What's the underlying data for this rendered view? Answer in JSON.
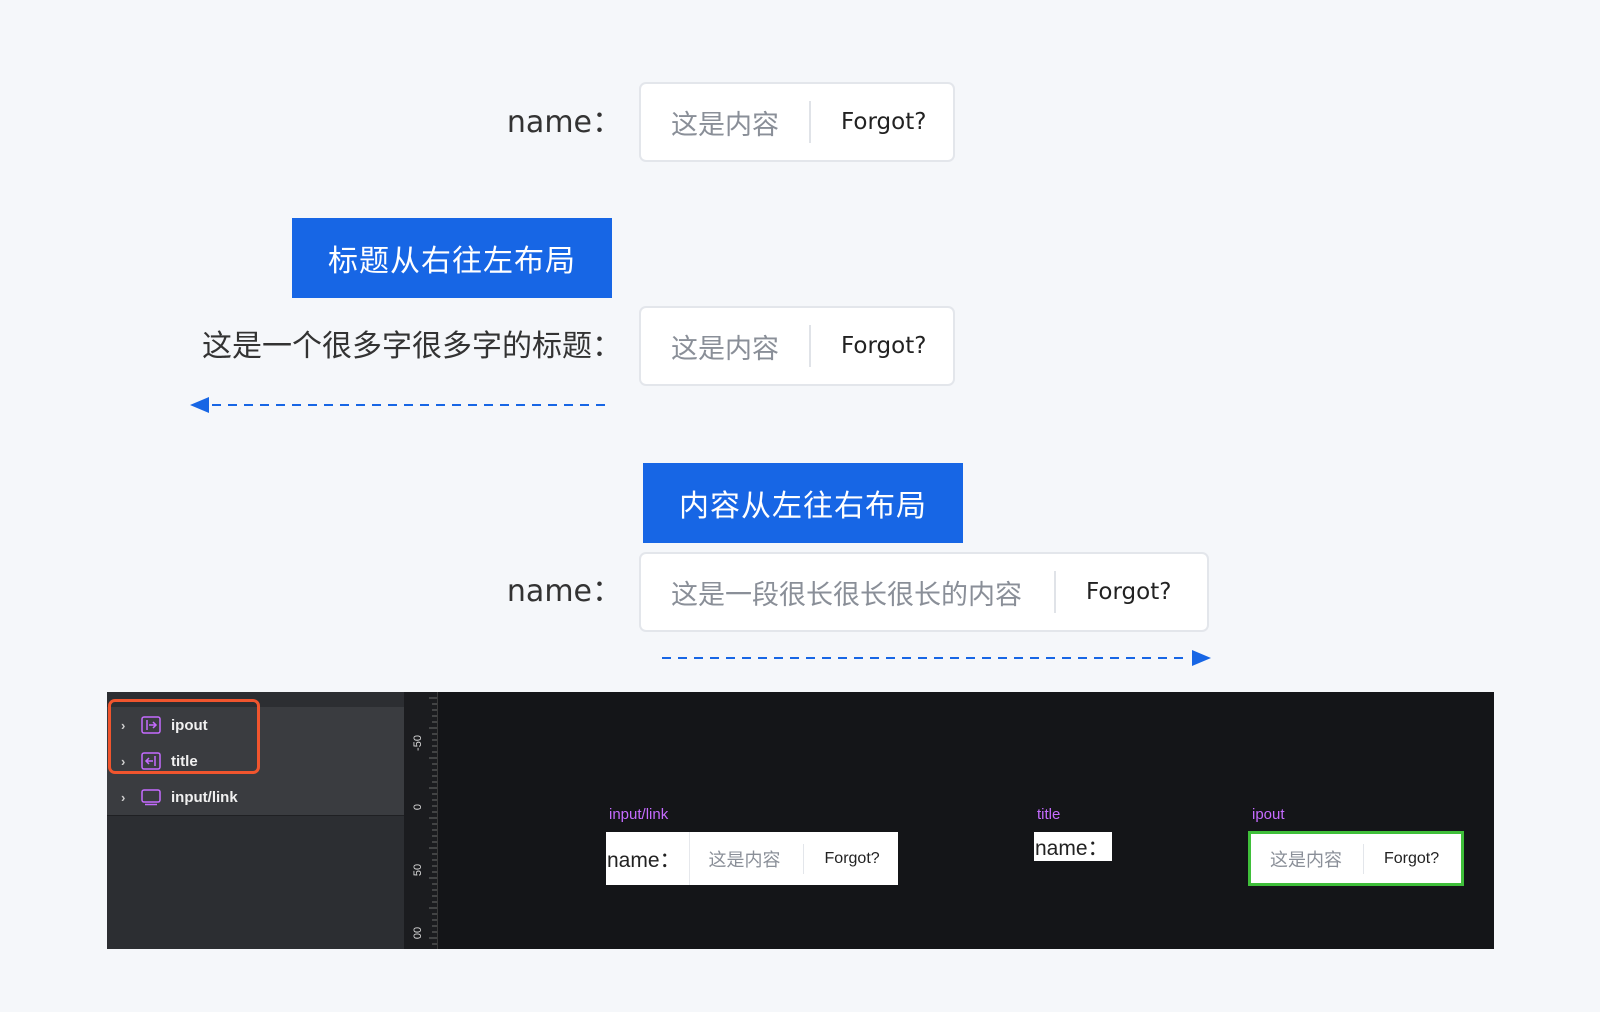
{
  "rows": [
    {
      "label": "name：",
      "value": "这是内容",
      "link": "Forgot?"
    },
    {
      "banner": "标题从右往左布局",
      "label": "这是一个很多字很多字的标题：",
      "value": "这是内容",
      "link": "Forgot?"
    },
    {
      "banner": "内容从左往右布局",
      "label": "name：",
      "value": "这是一段很长很长很长的内容",
      "link": "Forgot?"
    }
  ],
  "colors": {
    "accent": "#1766e5",
    "highlight": "#f0552e",
    "tag": "#c56bff",
    "selected_outline": "#3fbf3a"
  },
  "inspector": {
    "layers": [
      {
        "name": "ipout",
        "icon": "input-right-icon"
      },
      {
        "name": "title",
        "icon": "input-left-icon"
      },
      {
        "name": "input/link",
        "icon": "frame-icon"
      }
    ],
    "ruler_labels": [
      "-50",
      "0",
      "50",
      "00"
    ],
    "canvas": {
      "input_link": {
        "tag": "input/link",
        "label": "name：",
        "value": "这是内容",
        "link": "Forgot?"
      },
      "title": {
        "tag": "title",
        "label": "name："
      },
      "ipout": {
        "tag": "ipout",
        "value": "这是内容",
        "link": "Forgot?"
      }
    }
  }
}
